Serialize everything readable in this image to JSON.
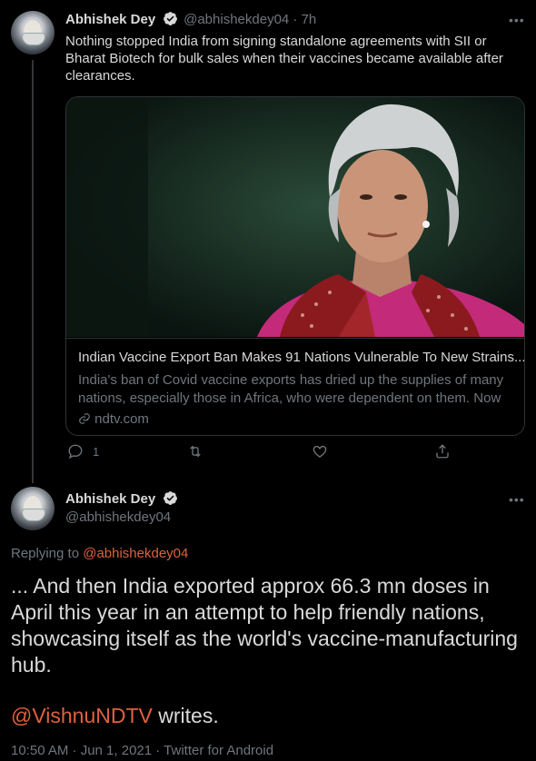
{
  "tweet1": {
    "display_name": "Abhishek Dey",
    "handle_time": "@abhishekdey04 · 7h",
    "text": "Nothing stopped India from signing standalone agreements with SII or Bharat Biotech for bulk sales when their vaccines became available after clearances.",
    "card": {
      "title": "Indian Vaccine Export Ban Makes 91 Nations Vulnerable To New Strains...",
      "description": "India's ban of Covid vaccine exports has dried up the supplies of many nations, especially those in Africa, who were dependent on them. Now ...",
      "domain": "ndtv.com"
    },
    "actions": {
      "reply_count": "1",
      "retweet_count": "",
      "like_count": ""
    }
  },
  "tweet2": {
    "display_name": "Abhishek Dey",
    "handle": "@abhishekdey04",
    "replying_to_label": "Replying to",
    "replying_to_handle": "@abhishekdey04",
    "text": "... And then India exported approx 66.3 mn doses in April this year in an attempt to help friendly nations, showcasing itself as the world's vaccine-manufacturing hub.",
    "mention": "@VishnuNDTV",
    "mention_suffix": " writes.",
    "timestamp": "10:50 AM · Jun 1, 2021 · Twitter for Android"
  },
  "colors": {
    "background": "#000000",
    "text": "#d9d9d9",
    "muted": "#6e767d",
    "mention": "#e0603e",
    "border": "#2f3336"
  },
  "icons": [
    "more-icon",
    "verified-badge-icon",
    "link-icon",
    "reply-icon",
    "retweet-icon",
    "like-icon",
    "share-icon"
  ]
}
